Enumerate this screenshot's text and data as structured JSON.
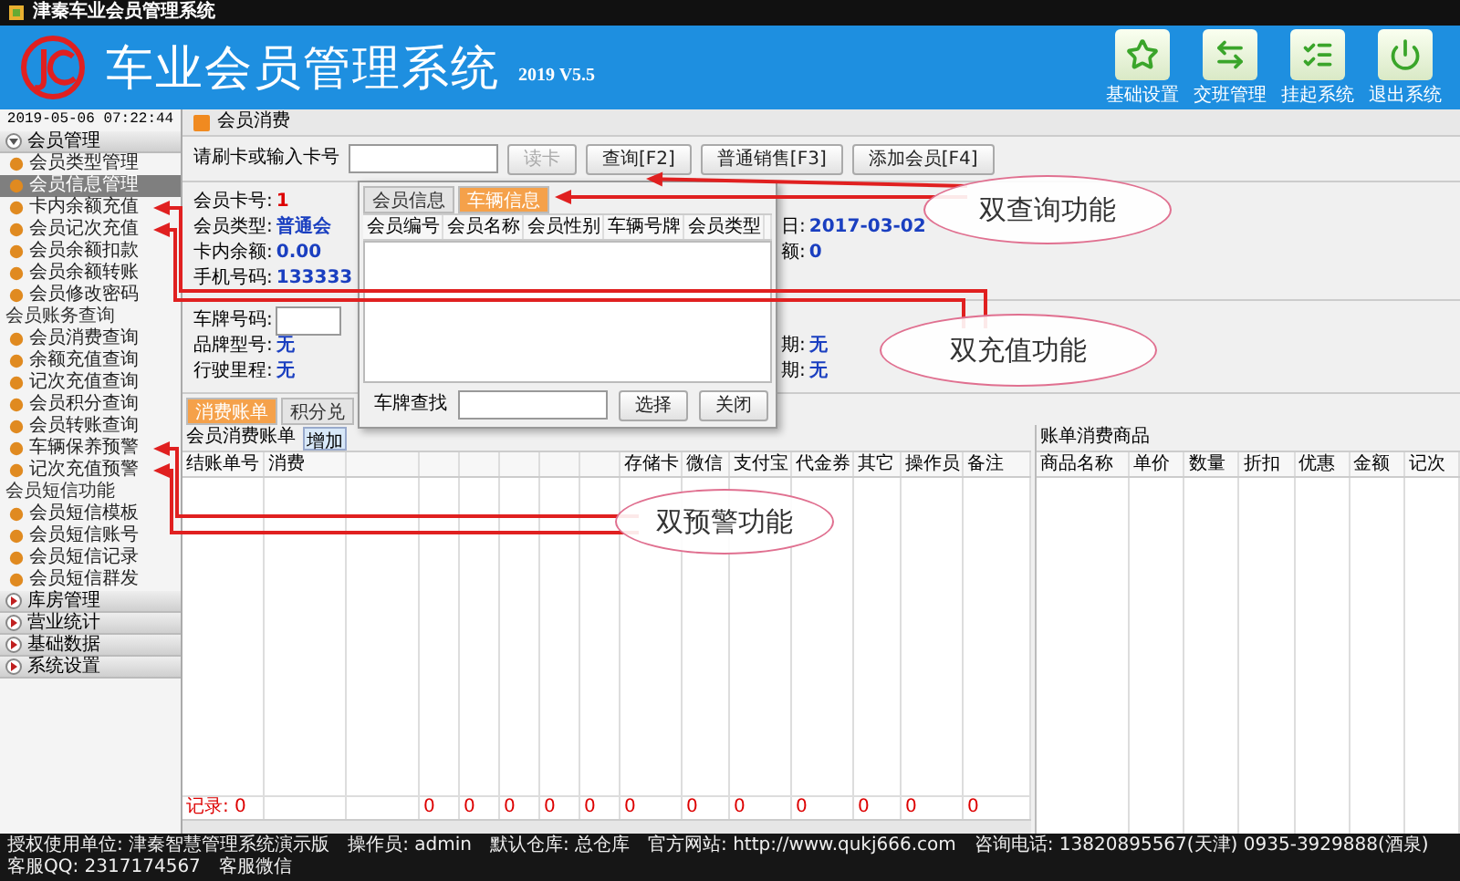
{
  "window": {
    "title": "津秦车业会员管理系统"
  },
  "header": {
    "title": "车业会员管理系统",
    "version": "2019 V5.5",
    "buttons": [
      {
        "label": "基础设置",
        "kind": "star"
      },
      {
        "label": "交班管理",
        "kind": "swap"
      },
      {
        "label": "挂起系统",
        "kind": "list"
      },
      {
        "label": "退出系统",
        "kind": "power"
      }
    ]
  },
  "sidebar": {
    "datetime": "2019-05-06 07:22:44",
    "entries": [
      {
        "kind": "group",
        "label": "会员管理",
        "expanded": true
      },
      {
        "kind": "item",
        "label": "会员类型管理",
        "selected": false
      },
      {
        "kind": "item",
        "label": "会员信息管理",
        "selected": true
      },
      {
        "kind": "item",
        "label": "卡内余额充值",
        "selected": false
      },
      {
        "kind": "item",
        "label": "会员记次充值",
        "selected": false
      },
      {
        "kind": "item",
        "label": "会员余额扣款",
        "selected": false
      },
      {
        "kind": "item",
        "label": "会员余额转账",
        "selected": false
      },
      {
        "kind": "item",
        "label": "会员修改密码",
        "selected": false
      },
      {
        "kind": "section",
        "label": "会员账务查询"
      },
      {
        "kind": "item",
        "label": "会员消费查询",
        "selected": false
      },
      {
        "kind": "item",
        "label": "余额充值查询",
        "selected": false
      },
      {
        "kind": "item",
        "label": "记次充值查询",
        "selected": false
      },
      {
        "kind": "item",
        "label": "会员积分查询",
        "selected": false
      },
      {
        "kind": "item",
        "label": "会员转账查询",
        "selected": false
      },
      {
        "kind": "item",
        "label": "车辆保养预警",
        "selected": false
      },
      {
        "kind": "item",
        "label": "记次充值预警",
        "selected": false
      },
      {
        "kind": "section",
        "label": "会员短信功能"
      },
      {
        "kind": "item",
        "label": "会员短信模板",
        "selected": false
      },
      {
        "kind": "item",
        "label": "会员短信账号",
        "selected": false
      },
      {
        "kind": "item",
        "label": "会员短信记录",
        "selected": false
      },
      {
        "kind": "item",
        "label": "会员短信群发",
        "selected": false
      },
      {
        "kind": "group",
        "label": "库房管理",
        "expanded": false
      },
      {
        "kind": "group",
        "label": "营业统计",
        "expanded": false
      },
      {
        "kind": "group",
        "label": "基础数据",
        "expanded": false
      },
      {
        "kind": "group",
        "label": "系统设置",
        "expanded": false
      }
    ]
  },
  "main": {
    "tab": "会员消费",
    "search": {
      "label": "请刷卡或输入卡号",
      "buttons": [
        {
          "label": "读卡",
          "disabled": true
        },
        {
          "label": "查询[F2]",
          "disabled": false
        },
        {
          "label": "普通销售[F3]",
          "disabled": false
        },
        {
          "label": "添加会员[F4]",
          "disabled": false
        }
      ]
    },
    "member_fields": [
      {
        "label": "会员卡号:",
        "value": "1",
        "kind": "card"
      },
      {
        "label": "会员类型:",
        "value": "普通会",
        "kind": "text"
      },
      {
        "label": "卡内余额:",
        "value": "0.00",
        "kind": "text"
      },
      {
        "label": "手机号码:",
        "value": "133333",
        "kind": "text"
      }
    ],
    "member_right_fields": [
      {
        "label": "日:",
        "value": "2017-03-02"
      },
      {
        "label": "额:",
        "value": "0"
      }
    ],
    "vehicle": {
      "plate_label": "车牌号码:",
      "fields": [
        {
          "label": "品牌型号:",
          "value": "无"
        },
        {
          "label": "行驶里程:",
          "value": "无"
        }
      ],
      "right_fields": [
        {
          "label": "期:",
          "value": "无"
        },
        {
          "label": "期:",
          "value": "无"
        }
      ]
    },
    "bill_tabs": [
      {
        "label": "消费账单",
        "selected": true
      },
      {
        "label": "积分兑",
        "selected": false
      }
    ],
    "bill": {
      "title": "会员消费账单",
      "add_button": "增加",
      "columns": [
        "结账单号",
        "消费",
        "存储卡",
        "微信",
        "支付宝",
        "代金券",
        "其它",
        "操作员",
        "备注"
      ],
      "record": "记录: 0",
      "totals": [
        "0",
        "0",
        "0",
        "0",
        "0",
        "0",
        "0",
        "0",
        "0",
        "0",
        "0",
        "0"
      ]
    },
    "products": {
      "title": "账单消费商品",
      "columns": [
        "商品名称",
        "单价",
        "数量",
        "折扣",
        "优惠",
        "金额",
        "记次"
      ]
    }
  },
  "popup": {
    "tabs": [
      {
        "label": "会员信息",
        "selected": false
      },
      {
        "label": "车辆信息",
        "selected": true
      }
    ],
    "columns": [
      "会员编号",
      "会员名称",
      "会员性别",
      "车辆号牌",
      "会员类型"
    ],
    "search_label": "车牌查找",
    "buttons": [
      "选择",
      "关闭"
    ]
  },
  "callouts": [
    {
      "text": "双查询功能"
    },
    {
      "text": "双充值功能"
    },
    {
      "text": "双预警功能"
    }
  ],
  "status_bar": [
    "授权使用单位: 津秦智慧管理系统演示版",
    "操作员: admin",
    "默认仓库: 总仓库",
    "官方网站: http://www.qukj666.com",
    "咨询电话: 13820895567(天津) 0935-3929888(酒泉)",
    "客服QQ: 2317174567",
    "客服微信"
  ]
}
